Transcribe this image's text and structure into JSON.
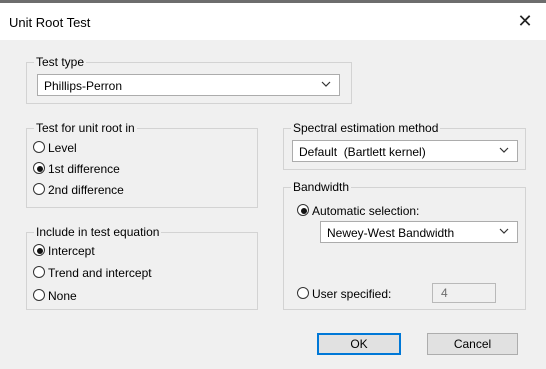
{
  "window": {
    "title": "Unit Root Test",
    "close_glyph": "✕"
  },
  "test_type": {
    "legend": "Test type",
    "selected": "Phillips-Perron"
  },
  "unit_root_in": {
    "legend": "Test for unit root in",
    "options": [
      "Level",
      "1st difference",
      "2nd difference"
    ],
    "selected": "1st difference"
  },
  "test_equation": {
    "legend": "Include in test equation",
    "options": [
      "Intercept",
      "Trend and intercept",
      "None"
    ],
    "selected": "Intercept"
  },
  "spectral": {
    "legend": "Spectral estimation method",
    "selected": "Default  (Bartlett kernel)"
  },
  "bandwidth": {
    "legend": "Bandwidth",
    "automatic_label": "Automatic selection:",
    "automatic_method": "Newey-West Bandwidth",
    "user_label": "User specified:",
    "user_value": "4",
    "selected": "automatic"
  },
  "buttons": {
    "ok": "OK",
    "cancel": "Cancel"
  },
  "colors": {
    "accent": "#0078d7",
    "background": "#f0f0f0",
    "titlebar": "#ffffff"
  }
}
